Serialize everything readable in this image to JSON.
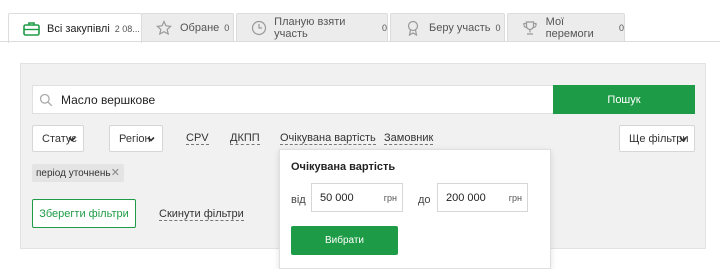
{
  "tabs": [
    {
      "label": "Всі закупівлі",
      "count": "2 08...",
      "icon": "briefcase-icon",
      "active": true
    },
    {
      "label": "Обране",
      "count": "0",
      "icon": "star-icon"
    },
    {
      "label": "Планую взяти участь",
      "count": "0",
      "icon": "clock-icon"
    },
    {
      "label": "Беру участь",
      "count": "0",
      "icon": "medal-icon"
    },
    {
      "label": "Мої перемоги",
      "count": "0",
      "icon": "trophy-icon"
    }
  ],
  "search": {
    "value": "Масло вершкове",
    "button": "Пошук",
    "icon": "search-icon"
  },
  "filters": {
    "status": "Статус",
    "region": "Регіон",
    "cpv": "CPV",
    "dkpp": "ДКПП",
    "expected": "Очікувана вартість",
    "customer": "Замовник",
    "more": "Ще фільтри"
  },
  "chip": {
    "label": "період уточнень"
  },
  "actions": {
    "save": "Зберегти фільтри",
    "reset": "Скинути фільтри"
  },
  "popup": {
    "title": "Очікувана вартість",
    "from_label": "від",
    "from_value": "50 000",
    "to_label": "до",
    "to_value": "200 000",
    "unit": "грн",
    "button": "Вибрати"
  },
  "colors": {
    "accent": "#1e9b46",
    "panel": "#f1f1f1"
  }
}
